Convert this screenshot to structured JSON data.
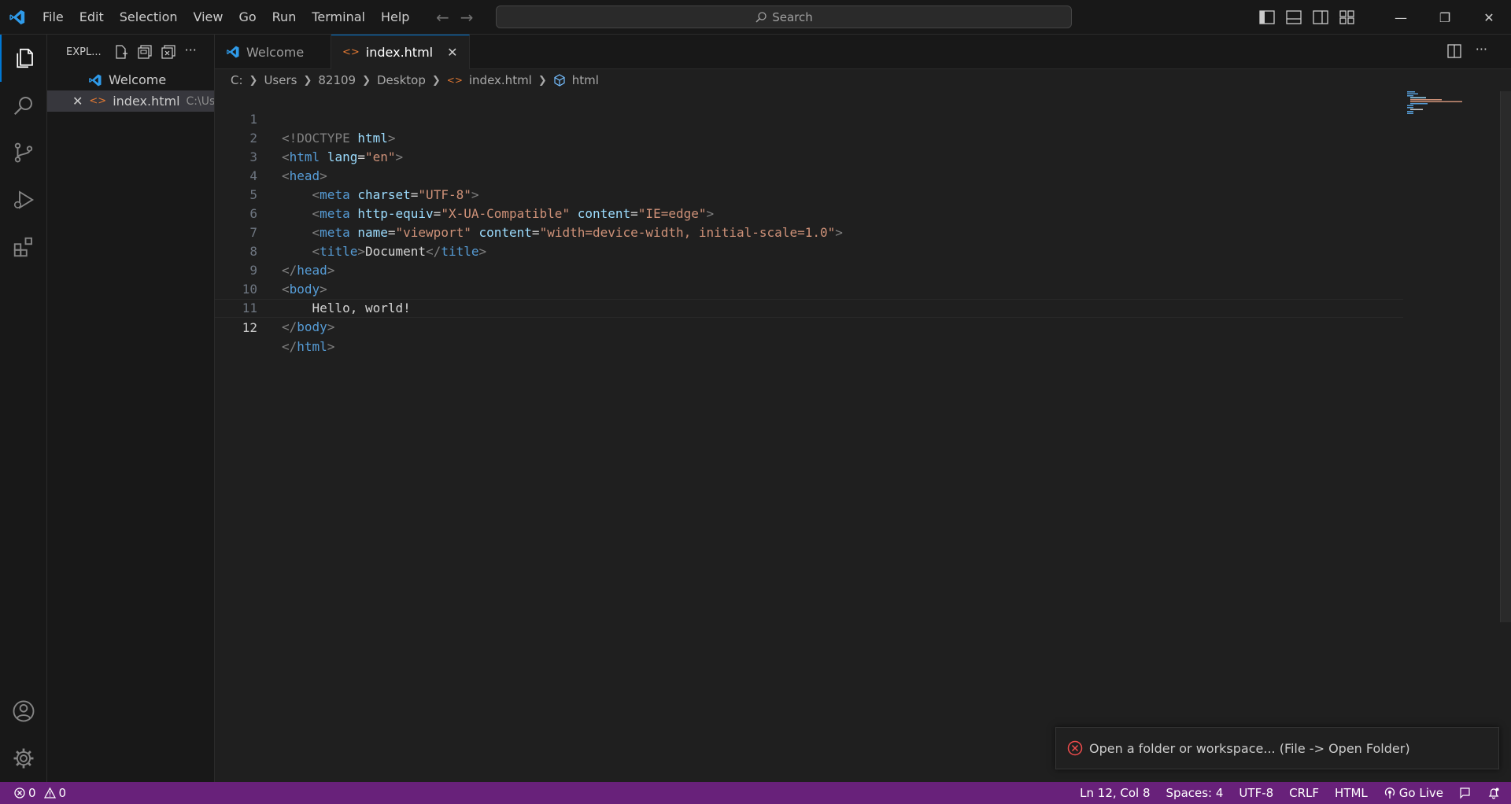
{
  "titlebar": {
    "menu": [
      "File",
      "Edit",
      "Selection",
      "View",
      "Go",
      "Run",
      "Terminal",
      "Help"
    ],
    "search_label": "Search"
  },
  "sidebar": {
    "header": "EXPL...",
    "open_editors": [
      {
        "label": "Welcome",
        "path": ""
      },
      {
        "label": "index.html",
        "path": "C:\\Us..."
      }
    ]
  },
  "tabs": [
    {
      "label": "Welcome",
      "active": false
    },
    {
      "label": "index.html",
      "active": true
    }
  ],
  "breadcrumb": [
    "C:",
    "Users",
    "82109",
    "Desktop",
    "index.html",
    "html"
  ],
  "editor": {
    "lines": [
      "1",
      "2",
      "3",
      "4",
      "5",
      "6",
      "7",
      "8",
      "9",
      "10",
      "11",
      "12"
    ],
    "tokens": {
      "doctype": "<!DOCTYPE",
      "html_kw": "html",
      "lang_attr": "lang",
      "lang_val": "\"en\"",
      "head": "head",
      "meta": "meta",
      "charset_attr": "charset",
      "charset_val": "\"UTF-8\"",
      "http_equiv_attr": "http-equiv",
      "http_equiv_val": "\"X-UA-Compatible\"",
      "content_attr": "content",
      "content_val1": "\"IE=edge\"",
      "name_attr": "name",
      "name_val": "\"viewport\"",
      "content_val2": "\"width=device-width, initial-scale=1.0\"",
      "title_tag": "title",
      "title_text": "Document",
      "body": "body",
      "hello": "Hello, world!"
    },
    "current_line": 12
  },
  "notification": {
    "message": "Open a folder or workspace... (File -> Open Folder)"
  },
  "statusbar": {
    "errors": "0",
    "warnings": "0",
    "position": "Ln 12, Col 8",
    "spaces": "Spaces: 4",
    "encoding": "UTF-8",
    "eol": "CRLF",
    "language": "HTML",
    "golive": "Go Live"
  },
  "colors": {
    "statusbar": "#68217a",
    "accent": "#0078d4",
    "tag": "#569cd6",
    "attr": "#9cdcfe",
    "string": "#ce9178"
  }
}
